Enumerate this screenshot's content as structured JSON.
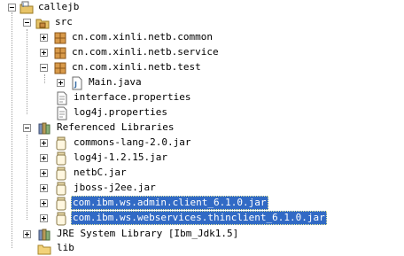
{
  "tree": {
    "project": {
      "label": "callejb",
      "icon": "java-project-icon"
    },
    "src": {
      "label": "src",
      "icon": "source-folder-icon"
    },
    "packages": [
      {
        "label": "cn.com.xinli.netb.common",
        "icon": "package-icon"
      },
      {
        "label": "cn.com.xinli.netb.service",
        "icon": "package-icon"
      },
      {
        "label": "cn.com.xinli.netb.test",
        "icon": "package-icon"
      }
    ],
    "main_java": {
      "label": "Main.java",
      "icon": "java-file-icon"
    },
    "interface_properties": {
      "label": "interface.properties",
      "icon": "properties-file-icon"
    },
    "log4j_properties": {
      "label": "log4j.properties",
      "icon": "properties-file-icon"
    },
    "referenced_libraries": {
      "label": "Referenced Libraries",
      "icon": "library-container-icon"
    },
    "jars": [
      {
        "label": "commons-lang-2.0.jar",
        "icon": "jar-icon"
      },
      {
        "label": "log4j-1.2.15.jar",
        "icon": "jar-icon"
      },
      {
        "label": "netbC.jar",
        "icon": "jar-icon"
      },
      {
        "label": "jboss-j2ee.jar",
        "icon": "jar-icon"
      },
      {
        "label": "com.ibm.ws.admin.client_6.1.0.jar",
        "icon": "jar-icon"
      },
      {
        "label": "com.ibm.ws.webservices.thinclient_6.1.0.jar",
        "icon": "jar-icon"
      }
    ],
    "jre": {
      "label": "JRE System Library [Ibm_Jdk1.5]",
      "icon": "jre-library-icon"
    },
    "lib": {
      "label": "lib",
      "icon": "folder-icon"
    }
  },
  "colors": {
    "selection": "#316ac5",
    "selection_text": "#ffffff"
  }
}
